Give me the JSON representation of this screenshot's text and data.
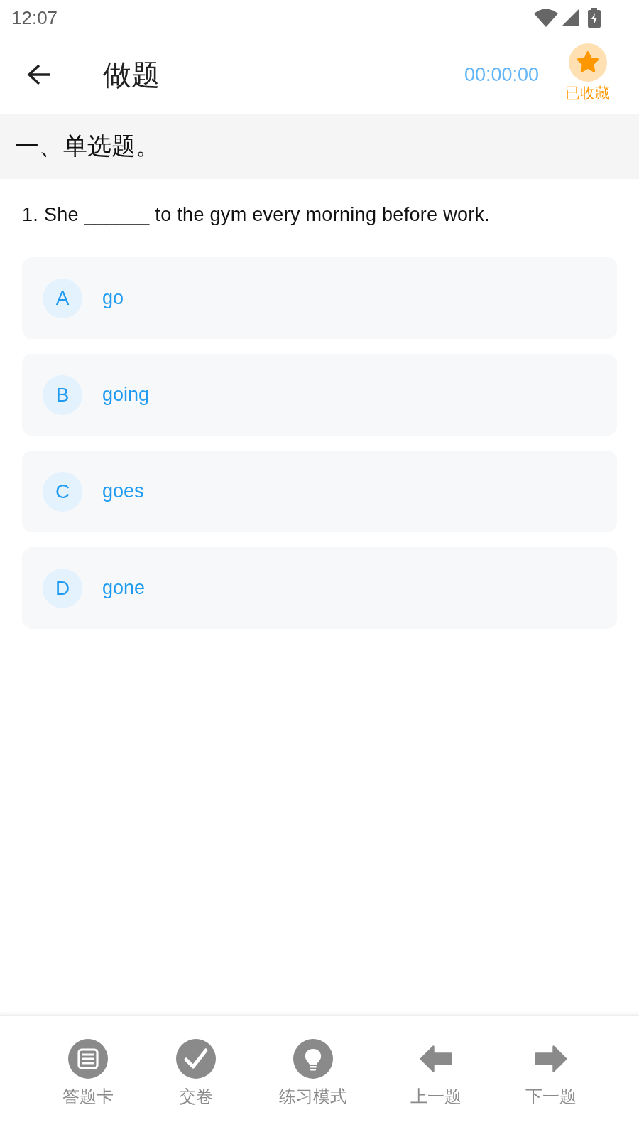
{
  "status_bar": {
    "time": "12:07"
  },
  "header": {
    "title": "做题",
    "timer": "00:00:00",
    "favorite": {
      "label": "已收藏",
      "favorited": true
    }
  },
  "section": {
    "title": "一、单选题。"
  },
  "question": {
    "text": "1. She ______ to the gym every morning before work.",
    "options": [
      {
        "letter": "A",
        "text": "go",
        "selected": false
      },
      {
        "letter": "B",
        "text": "going",
        "selected": false
      },
      {
        "letter": "C",
        "text": "goes",
        "selected": false
      },
      {
        "letter": "D",
        "text": "gone",
        "selected": false
      }
    ]
  },
  "bottom_bar": {
    "items": [
      {
        "kind": "card",
        "label": "答题卡"
      },
      {
        "kind": "submit",
        "label": "交卷"
      },
      {
        "kind": "mode",
        "label": "练习模式"
      },
      {
        "kind": "prev",
        "label": "上一题"
      },
      {
        "kind": "next",
        "label": "下一题"
      }
    ]
  }
}
